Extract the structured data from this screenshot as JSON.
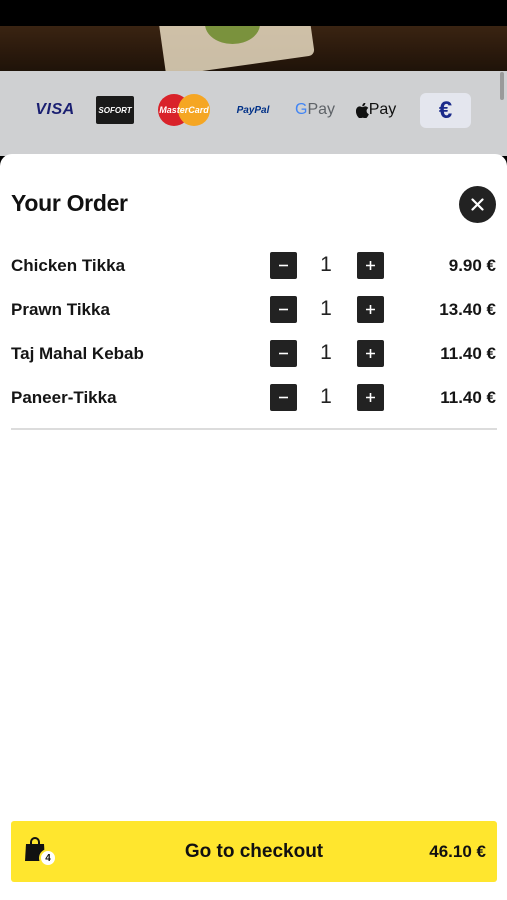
{
  "payments": {
    "visa": "VISA",
    "sofort": "SOFORT",
    "mastercard": "MasterCard",
    "paypal": "PayPal",
    "gpay_g": "G",
    "gpay_text": "Pay",
    "applepay": "Pay",
    "currency_symbol": "€"
  },
  "order": {
    "title": "Your Order",
    "items": [
      {
        "name": "Chicken Tikka",
        "qty": "1",
        "price": "9.90 €"
      },
      {
        "name": "Prawn Tikka",
        "qty": "1",
        "price": "13.40 €"
      },
      {
        "name": "Taj Mahal Kebab",
        "qty": "1",
        "price": "11.40 €"
      },
      {
        "name": "Paneer-Tikka",
        "qty": "1",
        "price": "11.40 €"
      }
    ]
  },
  "checkout": {
    "cart_count": "4",
    "label": "Go to checkout",
    "total": "46.10 €"
  },
  "colors": {
    "accent": "#ffe62e",
    "dark": "#222222"
  }
}
